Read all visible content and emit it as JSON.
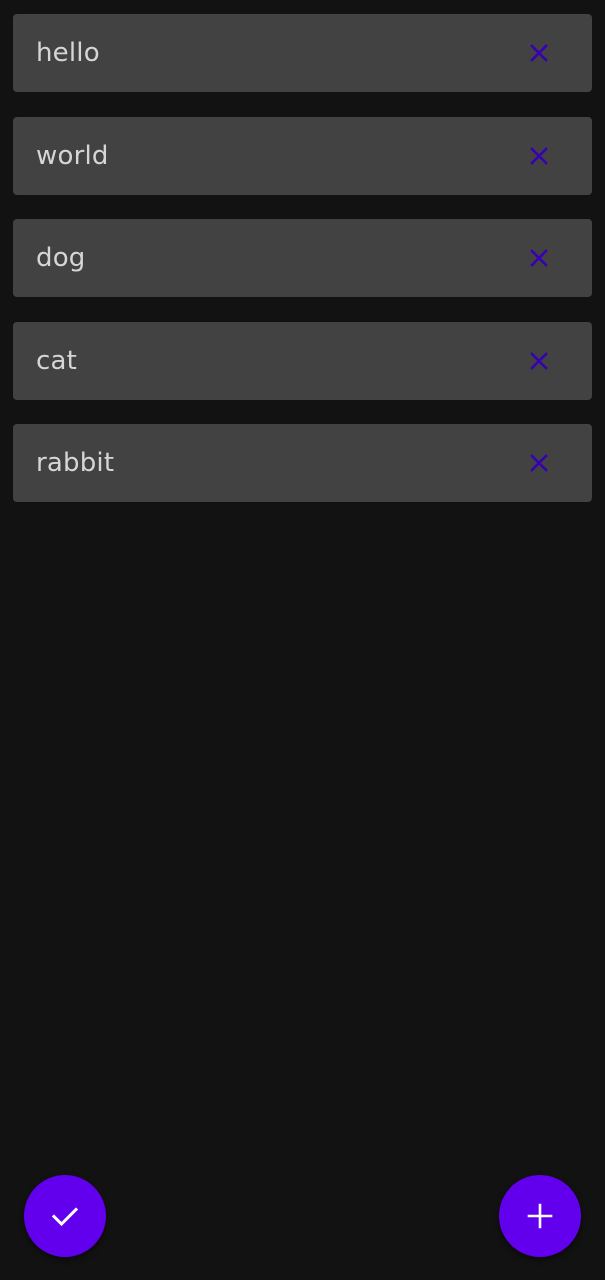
{
  "list": {
    "items": [
      {
        "label": "hello",
        "remove_icon": "close-icon"
      },
      {
        "label": "world",
        "remove_icon": "close-icon"
      },
      {
        "label": "dog",
        "remove_icon": "close-icon"
      },
      {
        "label": "cat",
        "remove_icon": "close-icon"
      },
      {
        "label": "rabbit",
        "remove_icon": "close-icon"
      }
    ]
  },
  "fabs": {
    "confirm_icon": "check-icon",
    "add_icon": "plus-icon"
  },
  "colors": {
    "background": "#121212",
    "item_background": "#424242",
    "item_text": "#d6d6d6",
    "accent": "#6200ee",
    "remove_icon": "#3700b3",
    "fab_icon": "#ffffff"
  }
}
